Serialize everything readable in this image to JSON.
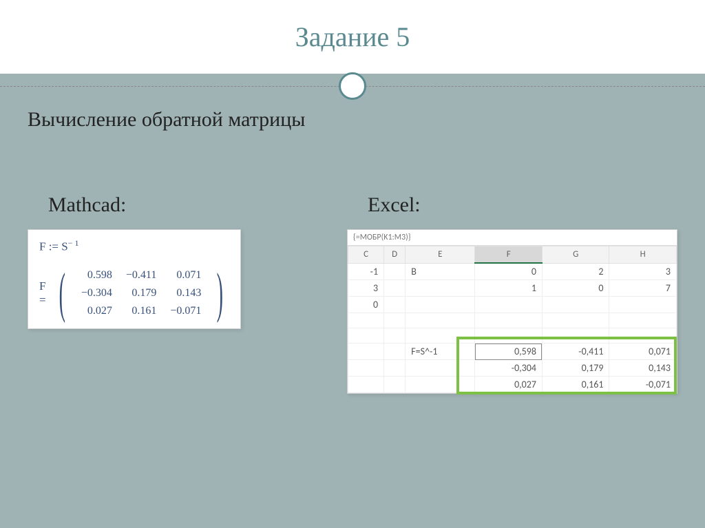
{
  "title": "Задание 5",
  "subtitle": "Вычисление обратной матрицы",
  "mathcad": {
    "label": "Mathcad:",
    "assign": "F := S",
    "assign_sup": "− 1",
    "eq_lhs": "F =",
    "matrix": [
      [
        "0.598",
        "−0.411",
        "0.071"
      ],
      [
        "−0.304",
        "0.179",
        "0.143"
      ],
      [
        "0.027",
        "0.161",
        "−0.071"
      ]
    ]
  },
  "excel": {
    "label": "Excel:",
    "formula_bar": "{=МОБР(K1:M3)}",
    "cols": [
      "C",
      "D",
      "E",
      "F",
      "G",
      "H"
    ],
    "active_col": "F",
    "rows_top": [
      {
        "C": "-1",
        "D": "",
        "E": "B",
        "F": "0",
        "G": "2",
        "H": "3"
      },
      {
        "C": "3",
        "D": "",
        "E": "",
        "F": "1",
        "G": "0",
        "H": "7"
      },
      {
        "C": "0",
        "D": "",
        "E": "",
        "F": "",
        "G": "",
        "H": ""
      }
    ],
    "result_label": "F=S^-1",
    "result": [
      [
        "0,598",
        "-0,411",
        "0,071"
      ],
      [
        "-0,304",
        "0,179",
        "0,143"
      ],
      [
        "0,027",
        "0,161",
        "-0,071"
      ]
    ]
  }
}
